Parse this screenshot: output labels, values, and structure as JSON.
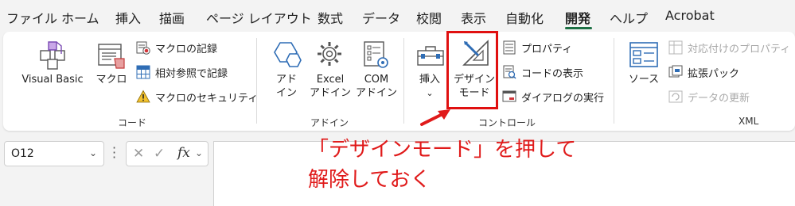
{
  "tabs": [
    "ファイル",
    "ホーム",
    "挿入",
    "描画",
    "ページ レイアウト",
    "数式",
    "データ",
    "校閲",
    "表示",
    "自動化",
    "開発",
    "ヘルプ",
    "Acrobat"
  ],
  "active_tab": "開発",
  "colors": {
    "accent": "#1e7145",
    "annotation": "#e01a1a",
    "icon_blue": "#2f6db5",
    "icon_red": "#d13438",
    "icon_yellow": "#f2c12e"
  },
  "groups": {
    "code": {
      "label": "コード",
      "visual_basic": "Visual Basic",
      "macro": "マクロ",
      "record_macro": "マクロの記録",
      "relative_ref": "相対参照で記録",
      "macro_security": "マクロのセキュリティ"
    },
    "addins": {
      "label": "アドイン",
      "addin_line1": "アド",
      "addin_line2": "イン",
      "excel_addin_line1": "Excel",
      "excel_addin_line2": "アドイン",
      "com_addin_line1": "COM",
      "com_addin_line2": "アドイン"
    },
    "controls": {
      "label": "コントロール",
      "insert": "挿入",
      "insert_chevron": "⌄",
      "design_mode_line1": "デザイン",
      "design_mode_line2": "モード",
      "properties": "プロパティ",
      "view_code": "コードの表示",
      "run_dialog": "ダイアログの実行"
    },
    "xml": {
      "label": "XML",
      "source": "ソース",
      "map_properties": "対応付けのプロパティ",
      "expansion_packs": "拡張パック",
      "refresh_data": "データの更新"
    }
  },
  "formula_bar": {
    "name_box": "O12",
    "name_box_chevron": "⌄",
    "cancel": "✕",
    "enter": "✓",
    "fx": "fx",
    "fx_chevron": "⌄"
  },
  "annotation": {
    "line1": "「デザインモード」を押して",
    "line2": "解除しておく"
  }
}
